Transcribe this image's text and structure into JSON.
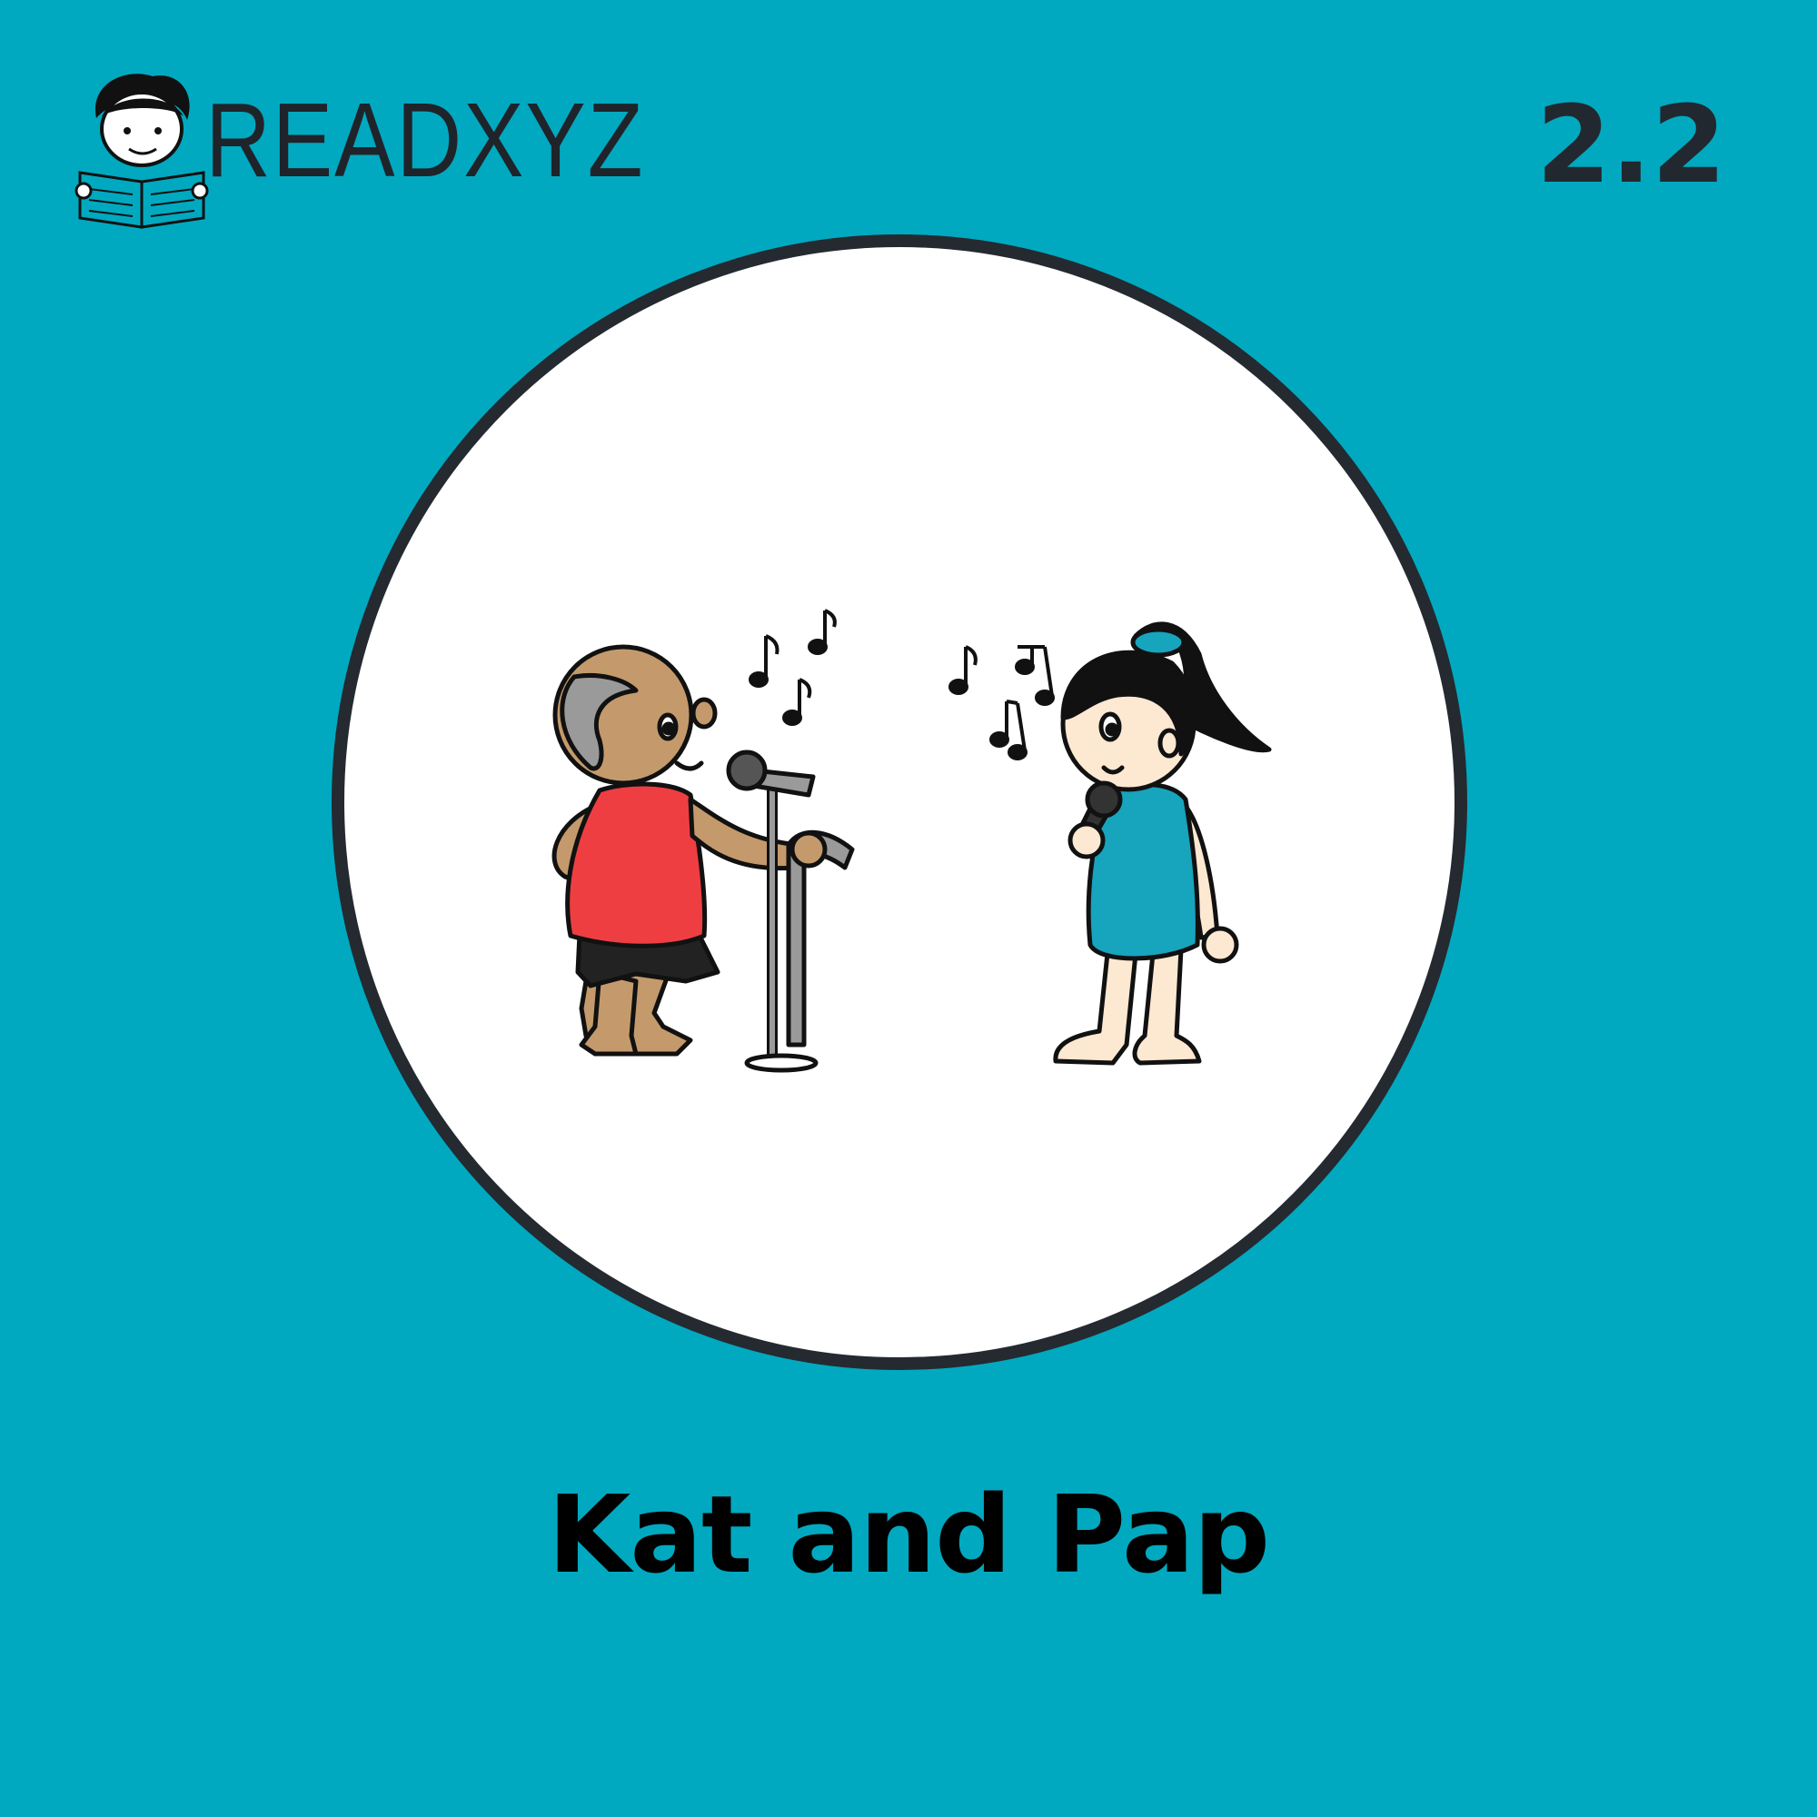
{
  "header": {
    "brand_name": "READXYZ",
    "logo": "boy-reading-book-logo",
    "level_number": "2.2"
  },
  "cover": {
    "illustration": "grandpa-and-girl-singing-with-microphones",
    "title": "Kat and Pap"
  },
  "colors": {
    "background": "#00a9c0",
    "circle_fill": "#ffffff",
    "circle_border": "#242a30",
    "text_dark": "#22282f",
    "grandpa_shirt": "#ef3e42",
    "girl_dress": "#17a4bd",
    "grandpa_skin": "#c49a6c",
    "girl_skin": "#fde8d2"
  }
}
